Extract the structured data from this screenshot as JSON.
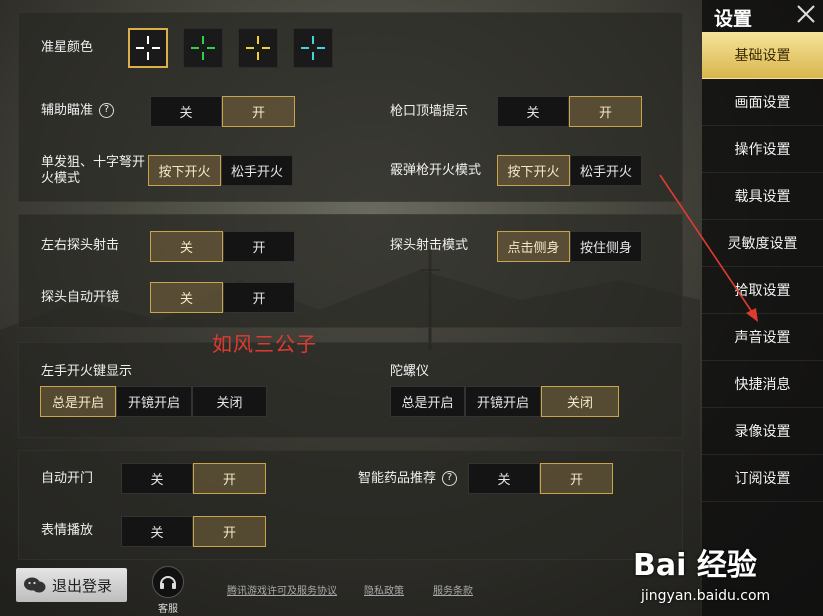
{
  "crosshair": {
    "label": "准星颜色",
    "colors": [
      {
        "name": "white",
        "color": "#ffffff",
        "selected": true
      },
      {
        "name": "green",
        "color": "#2fd14a",
        "selected": false
      },
      {
        "name": "yellow",
        "color": "#f2d232",
        "selected": false
      },
      {
        "name": "cyan",
        "color": "#3fd6e0",
        "selected": false
      }
    ]
  },
  "settings": {
    "aim_assist": {
      "label": "辅助瞄准",
      "help": "?",
      "off": "关",
      "on": "开"
    },
    "muzzle_hint": {
      "label": "枪口顶墙提示",
      "off": "关",
      "on": "开"
    },
    "single_shot": {
      "label": "单发狙、十字弩开火模式",
      "press": "按下开火",
      "release": "松手开火"
    },
    "shotgun": {
      "label": "霰弹枪开火模式",
      "press": "按下开火",
      "release": "松手开火"
    },
    "peek_fire": {
      "label": "左右探头射击",
      "off": "关",
      "on": "开"
    },
    "peek_mode": {
      "label": "探头射击模式",
      "tap": "点击侧身",
      "hold": "按住侧身"
    },
    "peek_scope": {
      "label": "探头自动开镜",
      "off": "关",
      "on": "开"
    },
    "left_fire": {
      "label": "左手开火键显示",
      "always": "总是开启",
      "scope": "开镜开启",
      "close": "关闭"
    },
    "gyro": {
      "label": "陀螺仪",
      "always": "总是开启",
      "scope": "开镜开启",
      "close": "关闭"
    },
    "auto_door": {
      "label": "自动开门",
      "off": "关",
      "on": "开"
    },
    "smart_med": {
      "label": "智能药品推荐",
      "help": "?",
      "off": "关",
      "on": "开"
    },
    "emote": {
      "label": "表情播放",
      "off": "关",
      "on": "开"
    }
  },
  "watermark_text": "如风三公子",
  "sidebar": {
    "title": "设置",
    "items": [
      {
        "label": "基础设置",
        "active": true
      },
      {
        "label": "画面设置",
        "active": false
      },
      {
        "label": "操作设置",
        "active": false
      },
      {
        "label": "载具设置",
        "active": false
      },
      {
        "label": "灵敏度设置",
        "active": false
      },
      {
        "label": "拾取设置",
        "active": false
      },
      {
        "label": "声音设置",
        "active": false
      },
      {
        "label": "快捷消息",
        "active": false
      },
      {
        "label": "录像设置",
        "active": false
      },
      {
        "label": "订阅设置",
        "active": false
      }
    ]
  },
  "footer": {
    "logout": "退出登录",
    "service": "客服",
    "links": [
      "腾讯游戏许可及服务协议",
      "隐私政策",
      "服务条款"
    ]
  },
  "baidu": {
    "brand": "Bai 经验",
    "url": "jingyan.baidu.com"
  },
  "colors": {
    "accent_gold": "#d9b04a",
    "arrow_red": "#e03b2f"
  }
}
